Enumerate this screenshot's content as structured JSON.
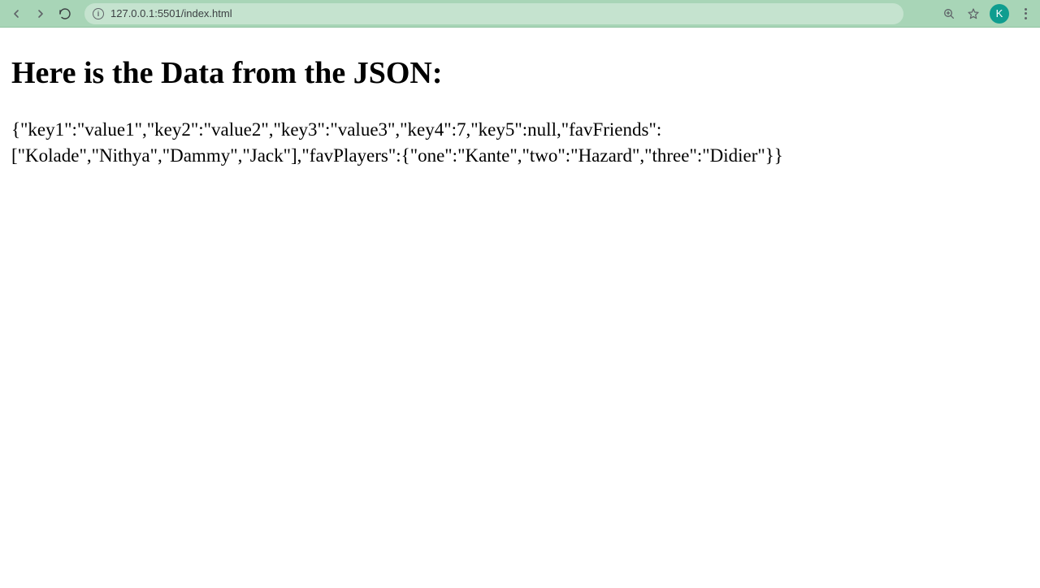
{
  "browser": {
    "url": "127.0.0.1:5501/index.html",
    "avatar_letter": "K"
  },
  "page": {
    "heading": "Here is the Data from the JSON:",
    "json_text": "{\"key1\":\"value1\",\"key2\":\"value2\",\"key3\":\"value3\",\"key4\":7,\"key5\":null,\"favFriends\":[\"Kolade\",\"Nithya\",\"Dammy\",\"Jack\"],\"favPlayers\":{\"one\":\"Kante\",\"two\":\"Hazard\",\"three\":\"Didier\"}}"
  }
}
